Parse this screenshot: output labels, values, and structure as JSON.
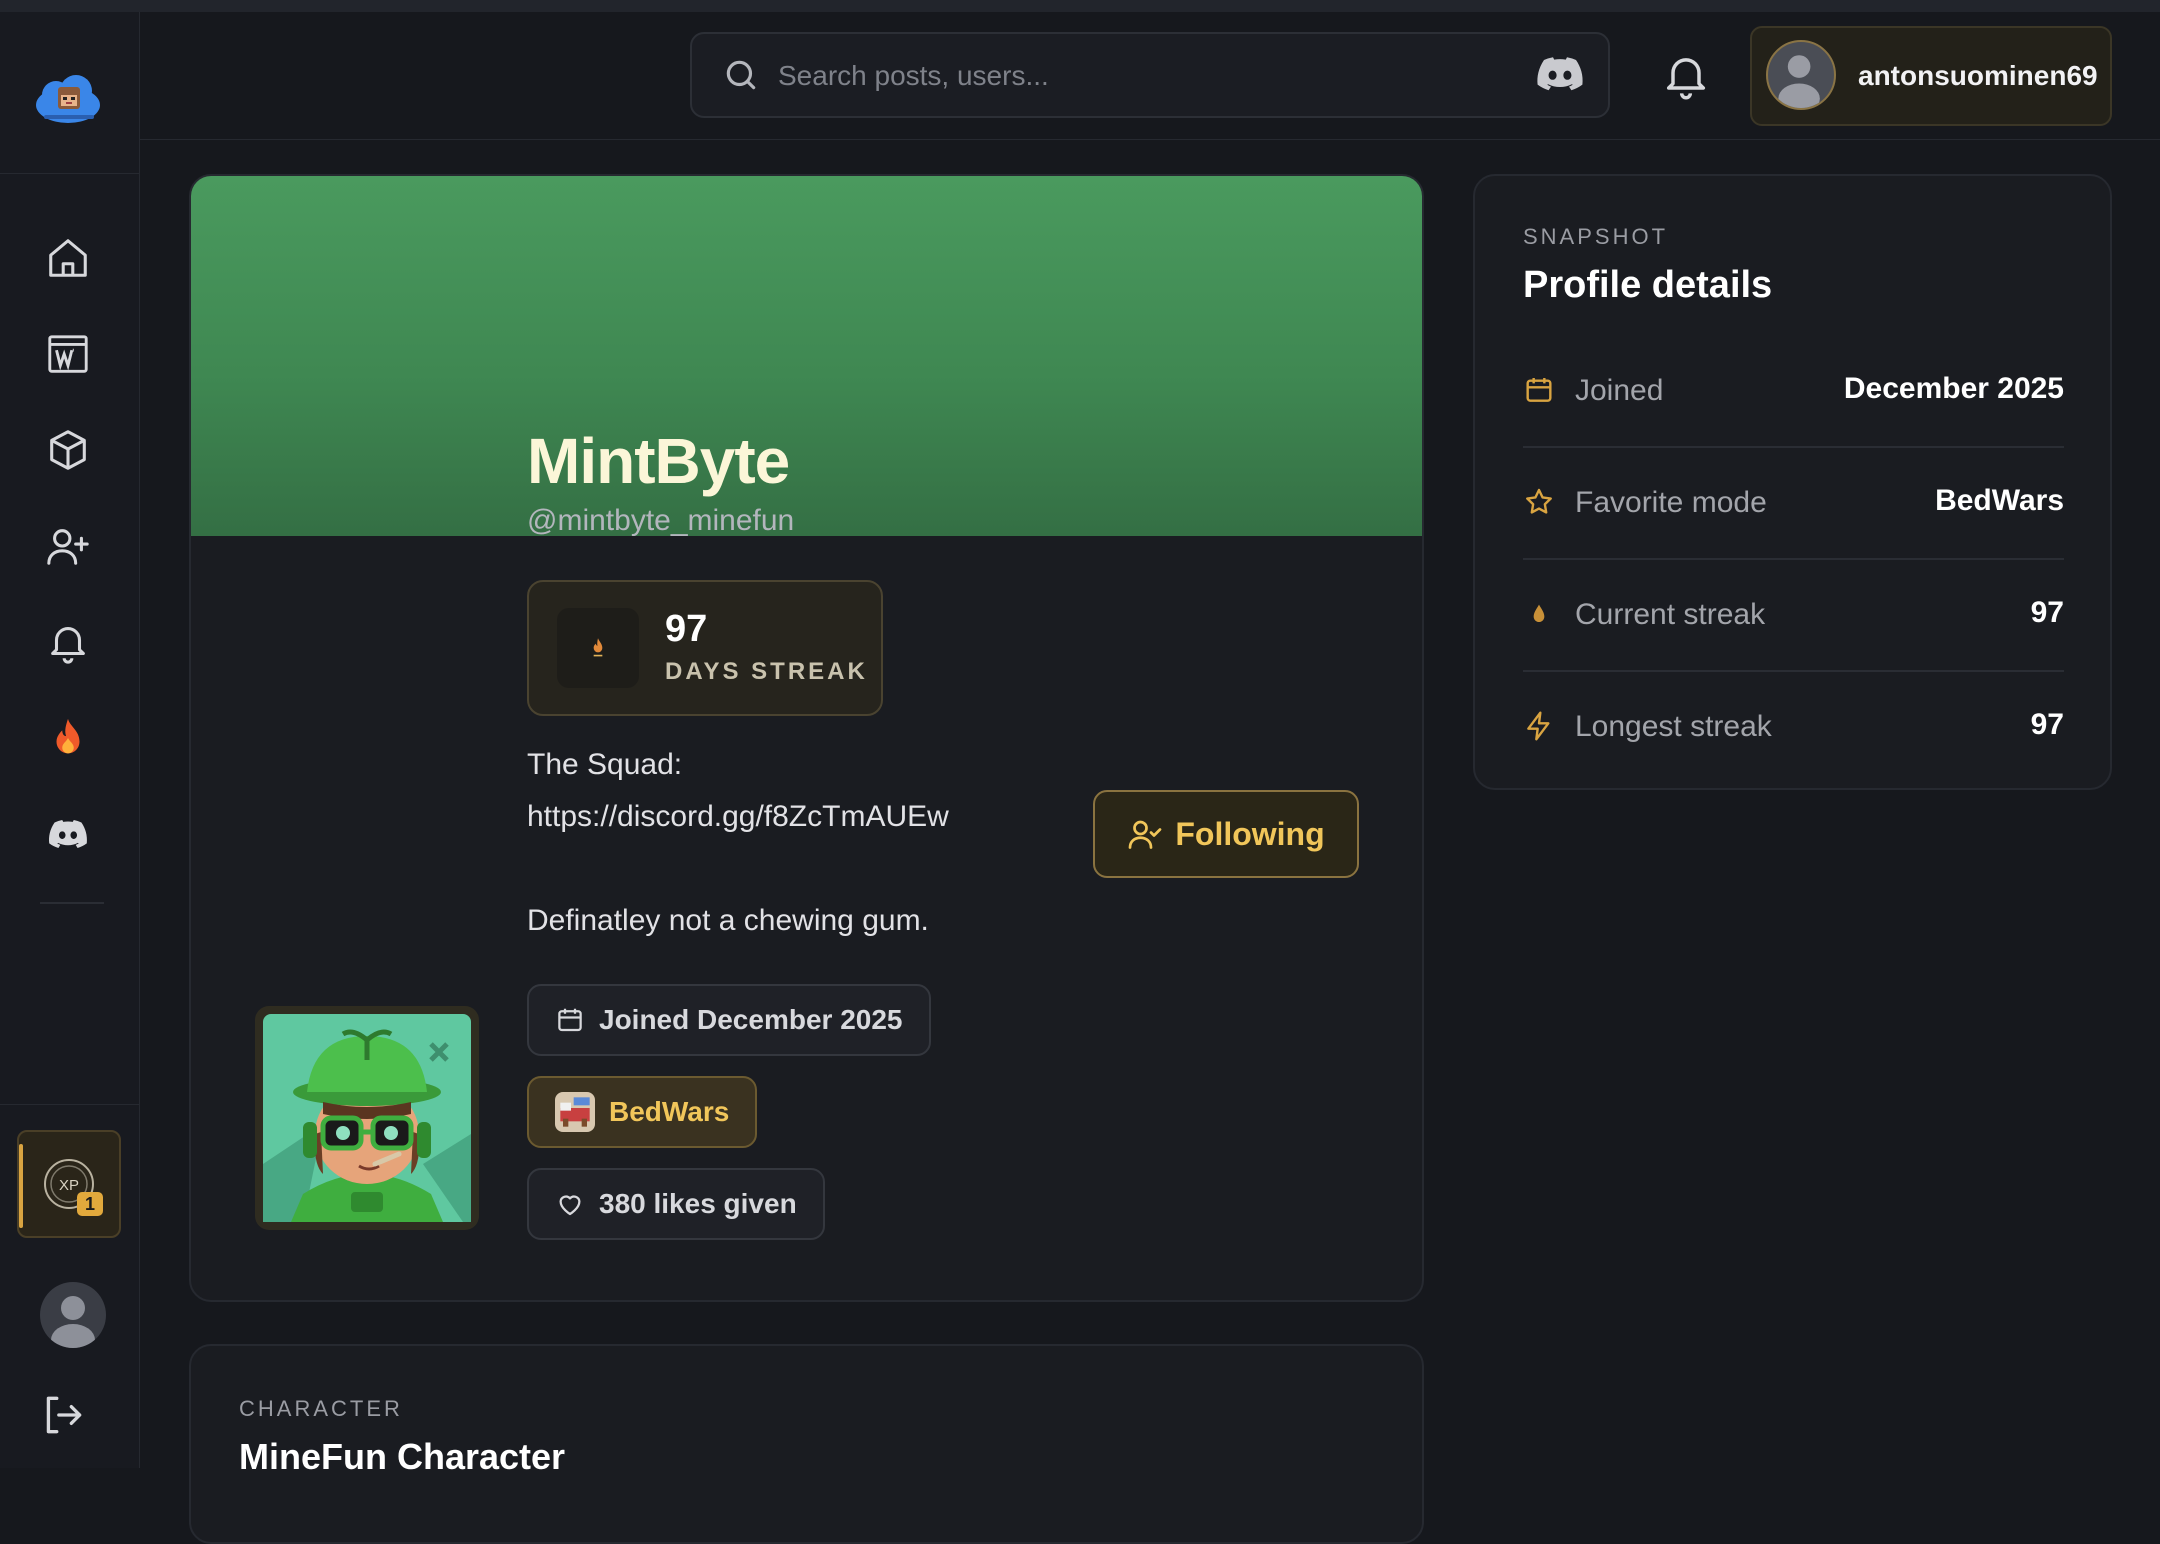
{
  "header": {
    "search_placeholder": "Search posts, users...",
    "username": "antonsuominen69"
  },
  "sidebar": {
    "items": [
      {
        "name": "home",
        "icon": "home-icon"
      },
      {
        "name": "wiki",
        "icon": "wiki-icon"
      },
      {
        "name": "cube",
        "icon": "cube-icon"
      },
      {
        "name": "add-friend",
        "icon": "user-plus-icon"
      },
      {
        "name": "notifications",
        "icon": "bell-icon"
      },
      {
        "name": "trending",
        "icon": "flame-icon"
      },
      {
        "name": "discord",
        "icon": "discord-icon"
      }
    ],
    "xp_label": "XP",
    "xp_level": "1"
  },
  "profile": {
    "name": "MintByte",
    "handle": "@mintbyte_minefun",
    "streak_count": "97",
    "streak_label": "DAYS STREAK",
    "bio_line1": "The Squad:",
    "bio_line2": "https://discord.gg/f8ZcTmAUEw",
    "bio_line3": "Definatley not a chewing gum.",
    "follow_label": "Following",
    "joined_pill": "Joined December 2025",
    "mode_pill": "BedWars",
    "likes_pill": "380 likes given"
  },
  "character": {
    "eyebrow": "CHARACTER",
    "title": "MineFun Character"
  },
  "details": {
    "eyebrow": "SNAPSHOT",
    "title": "Profile details",
    "rows": [
      {
        "label": "Joined",
        "value": "December 2025",
        "icon": "calendar-icon"
      },
      {
        "label": "Favorite mode",
        "value": "BedWars",
        "icon": "star-icon"
      },
      {
        "label": "Current streak",
        "value": "97",
        "icon": "drop-icon"
      },
      {
        "label": "Longest streak",
        "value": "97",
        "icon": "bolt-icon"
      }
    ]
  },
  "colors": {
    "accent_gold": "#f1c65a",
    "banner_green": "#4a9a5e",
    "background": "#16181d"
  }
}
